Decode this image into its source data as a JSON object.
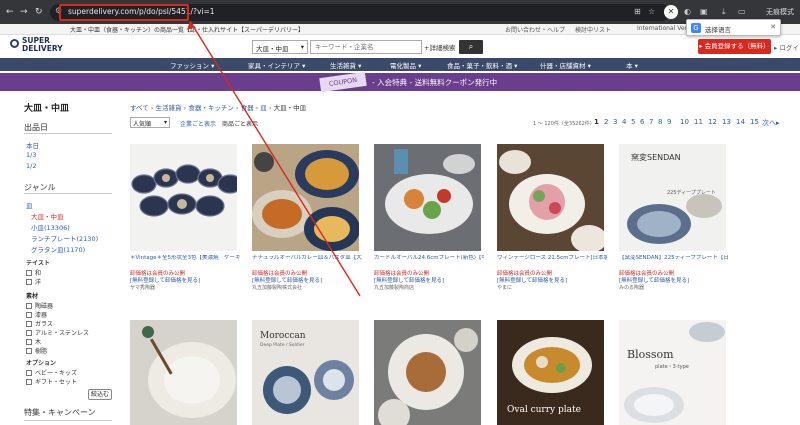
{
  "browser": {
    "url": "superdelivery.com/p/do/psl/5451/?vi=1",
    "tab_title": "大皿・中皿（食器・キッチン）の商品一覧【卸・仕入れサイト【スーパーデリバリー】",
    "incognito_label": "无痕模式",
    "translate_label": "选择语言",
    "translate_icon": "G",
    "bookmark_a": "お問い合わせ・ヘルプ",
    "bookmark_b": "検討中リスト",
    "bookmark_c": "International Ver."
  },
  "site": {
    "logo_text": "SUPER DELIVERY",
    "search_category": "大皿・中皿",
    "search_placeholder": "キーワード・企業名",
    "advanced_search": "+詳細検索",
    "register": "▸ 会員登録する（無料）",
    "login": "▸ ログイン"
  },
  "category_nav": [
    {
      "label": "ファッション ▾"
    },
    {
      "label": "家具・インテリア ▾"
    },
    {
      "label": "生活雑貨 ▾"
    },
    {
      "label": "電化製品 ▾"
    },
    {
      "label": "食品・菓子・飲料・酒 ▾"
    },
    {
      "label": "什器・店舗資材 ▾"
    },
    {
      "label": "本 ▾"
    }
  ],
  "coupon": {
    "badge": "COUPON",
    "message": "- 入会特典 - 送料無料クーポン発行中"
  },
  "sidebar": {
    "title": "大皿・中皿",
    "release_heading": "出品日",
    "release_items": [
      "本日",
      "1/3",
      "1/2"
    ],
    "genre_heading": "ジャンル",
    "genre_root": "皿",
    "genre_current": "大皿・中皿",
    "genre_items": [
      "小皿(13306)",
      "ランチプレート(2130)",
      "グラタン皿(1170)"
    ],
    "taste_heading": "テイスト",
    "taste_items": [
      "和",
      "洋"
    ],
    "material_heading": "素材",
    "material_items": [
      "陶磁器",
      "漆器",
      "ガラス",
      "アルミ・ステンレス",
      "木",
      "樹脂"
    ],
    "option_heading": "オプション",
    "option_items": [
      "ベビー・キッズ",
      "ギフト・セット"
    ],
    "narrow_button": "絞込む",
    "feature_heading": "特集・キャンペーン"
  },
  "main": {
    "breadcrumb": [
      "すべて",
      "生活雑貨",
      "食器・キッチン",
      "食器",
      "皿",
      "大皿・中皿"
    ],
    "breadcrumb_sep": "›",
    "sort": "人気順",
    "view_company": "企業ごと表示",
    "view_product": "商品ごと表示",
    "result_count": "1 ～ 120件（全35262件）",
    "pages": [
      "1",
      "2",
      "3",
      "4",
      "5",
      "6",
      "7",
      "8",
      "9",
      "10",
      "11",
      "12",
      "13",
      "14",
      "15",
      "次へ▸"
    ]
  },
  "products": [
    {
      "name": "＊Vintage＊全5形状全3色【美濃焼　ケーキ皿　ボウル　パスタ皿　深皿　和食器",
      "price": "卸価格は会員のみ公開",
      "link": "[無料登録して卸価格を見る]",
      "shop": "ヤマ秀陶器"
    },
    {
      "name": "ナチュラルオーバルカレー皿＆パスタ皿【大皿 日本製 美濃焼 和食器】",
      "price": "卸価格は会員のみ公開",
      "link": "[無料登録して卸価格を見る]",
      "shop": "丸五加藤製陶株式会社"
    },
    {
      "name": "カードルオーバル24.6cmプレート(新色)【中皿 日本製 美濃焼】",
      "price": "卸価格は会員のみ公開",
      "link": "[無料登録して卸価格を見る]",
      "shop": "丸五加藤製陶商店"
    },
    {
      "name": "ウィンテージローズ 21.5cmプレート[日本製/美濃焼/洋食器]",
      "price": "卸価格は会員のみ公開",
      "link": "[無料登録して卸価格を見る]",
      "shop": "やまに"
    },
    {
      "name": "【窯変SENDAN】225ディーププレート【日本製 美濃焼 大皿】オリジナル",
      "price": "卸価格は会員のみ公開",
      "link": "[無料登録して卸価格を見る]",
      "shop": "みのる陶器"
    }
  ],
  "product_images": {
    "img5_title": "窯変SENDAN",
    "img5_sub": "225ディーププレート",
    "img7_title": "Moroccan",
    "img7_sub": "Deep Plate / Soldier",
    "img9_title": "Oval curry plate",
    "img10_title": "Blossom",
    "img10_sub": "plate・3-type"
  },
  "colors": {
    "accent_red": "#d9281e",
    "link_blue": "#2a5db0",
    "nav_bg": "#3b4a6b",
    "coupon_bg": "#6a3d8e"
  }
}
